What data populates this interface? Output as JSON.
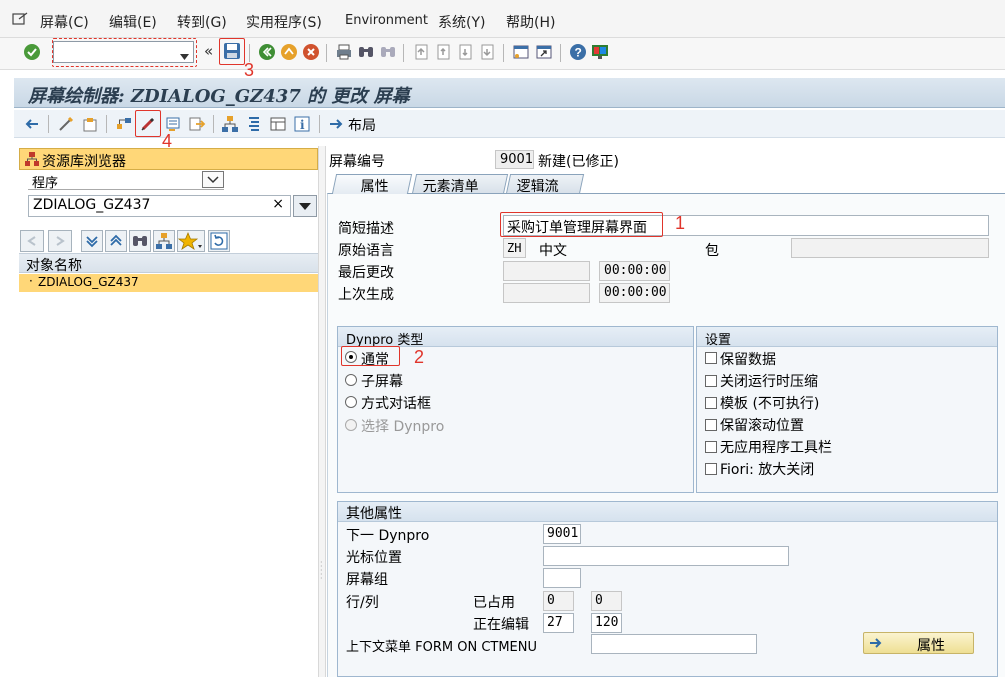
{
  "menu": {
    "items": [
      "屏幕(C)",
      "编辑(E)",
      "转到(G)",
      "实用程序(S)",
      "Environment",
      "系统(Y)",
      "帮助(H)"
    ]
  },
  "toolbar": {
    "command_value": ""
  },
  "title": "屏幕绘制器: ZDIALOG_GZ437 的 更改 屏幕",
  "app_toolbar": {
    "layout_label": "布局"
  },
  "annotations": [
    "1",
    "2",
    "3",
    "4"
  ],
  "left_panel": {
    "repo_browser_title": "资源库浏览器",
    "object_type": "程序",
    "object_name_value": "ZDIALOG_GZ437",
    "tree_header": "对象名称",
    "tree_items": [
      "ZDIALOG_GZ437"
    ]
  },
  "screen": {
    "number_label": "屏幕编号",
    "number_value": "9001",
    "status": "新建(已修正)"
  },
  "tabs": [
    {
      "label": "属性",
      "active": true
    },
    {
      "label": "元素清单",
      "active": false
    },
    {
      "label": "逻辑流",
      "active": false
    }
  ],
  "attributes": {
    "short_desc_label": "简短描述",
    "short_desc_value": "采购订单管理屏幕界面",
    "orig_lang_label": "原始语言",
    "orig_lang_code": "ZH",
    "orig_lang_name": "中文",
    "package_label": "包",
    "package_value": "",
    "last_changed_label": "最后更改",
    "last_changed_date": "",
    "last_changed_time": "00:00:00",
    "last_generated_label": "上次生成",
    "last_generated_date": "",
    "last_generated_time": "00:00:00"
  },
  "dynpro_type": {
    "title": "Dynpro 类型",
    "options": [
      {
        "label": "通常",
        "selected": true,
        "disabled": false
      },
      {
        "label": "子屏幕",
        "selected": false,
        "disabled": false
      },
      {
        "label": "方式对话框",
        "selected": false,
        "disabled": false
      },
      {
        "label": "选择 Dynpro",
        "selected": false,
        "disabled": true
      }
    ]
  },
  "settings": {
    "title": "设置",
    "options": [
      {
        "label": "保留数据",
        "checked": false
      },
      {
        "label": "关闭运行时压缩",
        "checked": false
      },
      {
        "label": "模板 (不可执行)",
        "checked": false
      },
      {
        "label": "保留滚动位置",
        "checked": false
      },
      {
        "label": "无应用程序工具栏",
        "checked": false
      },
      {
        "label": "Fiori: 放大关闭",
        "checked": false
      }
    ]
  },
  "other_attributes": {
    "title": "其他属性",
    "next_dynpro_label": "下一 Dynpro",
    "next_dynpro_value": "9001",
    "cursor_pos_label": "光标位置",
    "cursor_pos_value": "",
    "screen_group_label": "屏幕组",
    "screen_group_value": "",
    "row_col_label": "行/列",
    "used_label": "已占用",
    "used_row": "0",
    "used_col": "0",
    "editing_label": "正在编辑",
    "edit_row": "27",
    "edit_col": "120",
    "context_menu_label": "上下文菜单 FORM ON CTMENU",
    "context_menu_value": "",
    "attributes_button": "属性"
  }
}
